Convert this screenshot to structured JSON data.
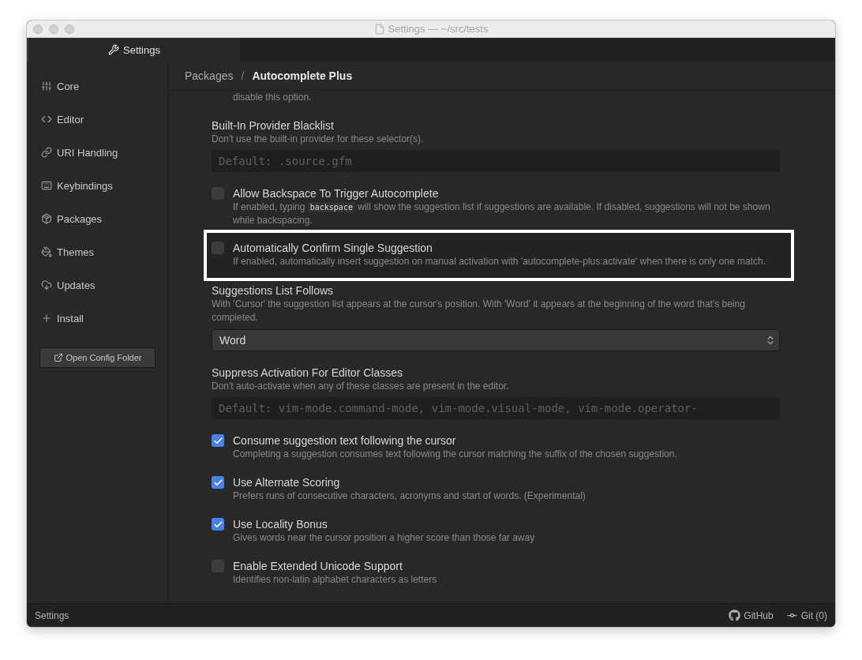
{
  "window": {
    "title": "Settings — ~/src/tests"
  },
  "tabs": [
    {
      "label": "Settings",
      "selected": true
    }
  ],
  "sidebar": {
    "items": [
      {
        "label": "Core",
        "selected": false
      },
      {
        "label": "Editor",
        "selected": false
      },
      {
        "label": "URI Handling",
        "selected": false
      },
      {
        "label": "Keybindings",
        "selected": false
      },
      {
        "label": "Packages",
        "selected": false
      },
      {
        "label": "Themes",
        "selected": false
      },
      {
        "label": "Updates",
        "selected": false
      },
      {
        "label": "Install",
        "selected": false
      }
    ],
    "button": "Open Config Folder"
  },
  "breadcrumb": {
    "items": [
      "Packages",
      "Autocomplete Plus"
    ],
    "separator": "/"
  },
  "settings": [
    {
      "kind": "note",
      "description": "disable this option."
    },
    {
      "kind": "field",
      "title": "Built-In Provider Blacklist",
      "description": "Don't use the built-in provider for these selector(s).",
      "placeholder": "Default: .source.gfm"
    },
    {
      "kind": "checkbox",
      "title": "Allow Backspace To Trigger Autocomplete",
      "description": "If enabled, typing ",
      "code": "backspace",
      "description_after": " will show the suggestion list if suggestions are available. If disabled, suggestions will not be shown while backspacing.",
      "checked": false,
      "highlighted": false
    },
    {
      "kind": "checkbox",
      "title": "Automatically Confirm Single Suggestion",
      "description": "If enabled, automatically insert suggestion on manual activation with 'autocomplete-plus:activate' when there is only one match.",
      "checked": false,
      "highlighted": true
    },
    {
      "kind": "select",
      "title": "Suggestions List Follows",
      "description": "With 'Cursor' the suggestion list appears at the cursor's position. With 'Word' it appears at the beginning of the word that's being completed.",
      "value": "Word"
    },
    {
      "kind": "field",
      "title": "Suppress Activation For Editor Classes",
      "description": "Don't auto-activate when any of these classes are present in the editor.",
      "placeholder": "Default: vim-mode.command-mode, vim-mode.visual-mode, vim-mode.operator-"
    },
    {
      "kind": "checkbox",
      "title": "Consume suggestion text following the cursor",
      "description": "Completing a suggestion consumes text following the cursor matching the suffix of the chosen suggestion.",
      "checked": true,
      "highlighted": false
    },
    {
      "kind": "checkbox",
      "title": "Use Alternate Scoring",
      "description": "Prefers runs of consecutive characters, acronyms and start of words. (Experimental)",
      "checked": true,
      "highlighted": false
    },
    {
      "kind": "checkbox",
      "title": "Use Locality Bonus",
      "description": "Gives words near the cursor position a higher score than those far away",
      "checked": true,
      "highlighted": false
    },
    {
      "kind": "checkbox",
      "title": "Enable Extended Unicode Support",
      "description": "Identifies non-latin alphabet characters as letters",
      "checked": false,
      "highlighted": false
    }
  ],
  "status_bar": {
    "left": "Settings",
    "github": "GitHub",
    "git": "Git (0)"
  }
}
